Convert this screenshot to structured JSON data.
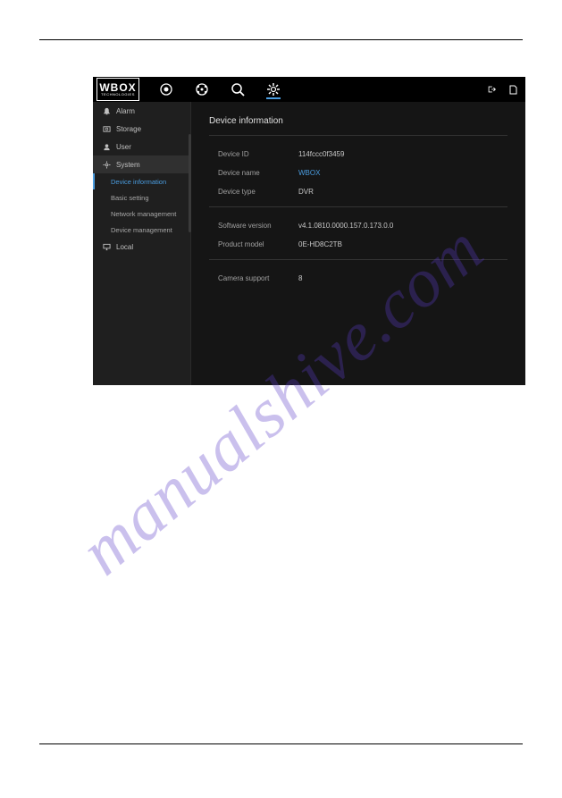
{
  "logo": {
    "main": "WBOX",
    "sub": "TECHNOLOGIES"
  },
  "topnav": {
    "live": "live-icon",
    "playback": "playback-icon",
    "search": "search-icon",
    "settings": "settings-icon"
  },
  "sidebar": {
    "items": [
      {
        "label": "Alarm"
      },
      {
        "label": "Storage"
      },
      {
        "label": "User"
      },
      {
        "label": "System",
        "selected": true
      },
      {
        "label": "Local"
      }
    ],
    "subitems": [
      {
        "label": "Device information",
        "active": true
      },
      {
        "label": "Basic setting"
      },
      {
        "label": "Network management"
      },
      {
        "label": "Device management"
      }
    ]
  },
  "panel": {
    "title": "Device information",
    "rows1": [
      {
        "label": "Device ID",
        "value": "114fccc0f3459"
      },
      {
        "label": "Device name",
        "value": "WBOX",
        "link": true
      },
      {
        "label": "Device type",
        "value": "DVR"
      }
    ],
    "rows2": [
      {
        "label": "Software version",
        "value": "v4.1.0810.0000.157.0.173.0.0"
      },
      {
        "label": "Product model",
        "value": "0E-HD8C2TB"
      }
    ],
    "rows3": [
      {
        "label": "Camera support",
        "value": "8"
      }
    ]
  },
  "watermark": "manualshive.com"
}
